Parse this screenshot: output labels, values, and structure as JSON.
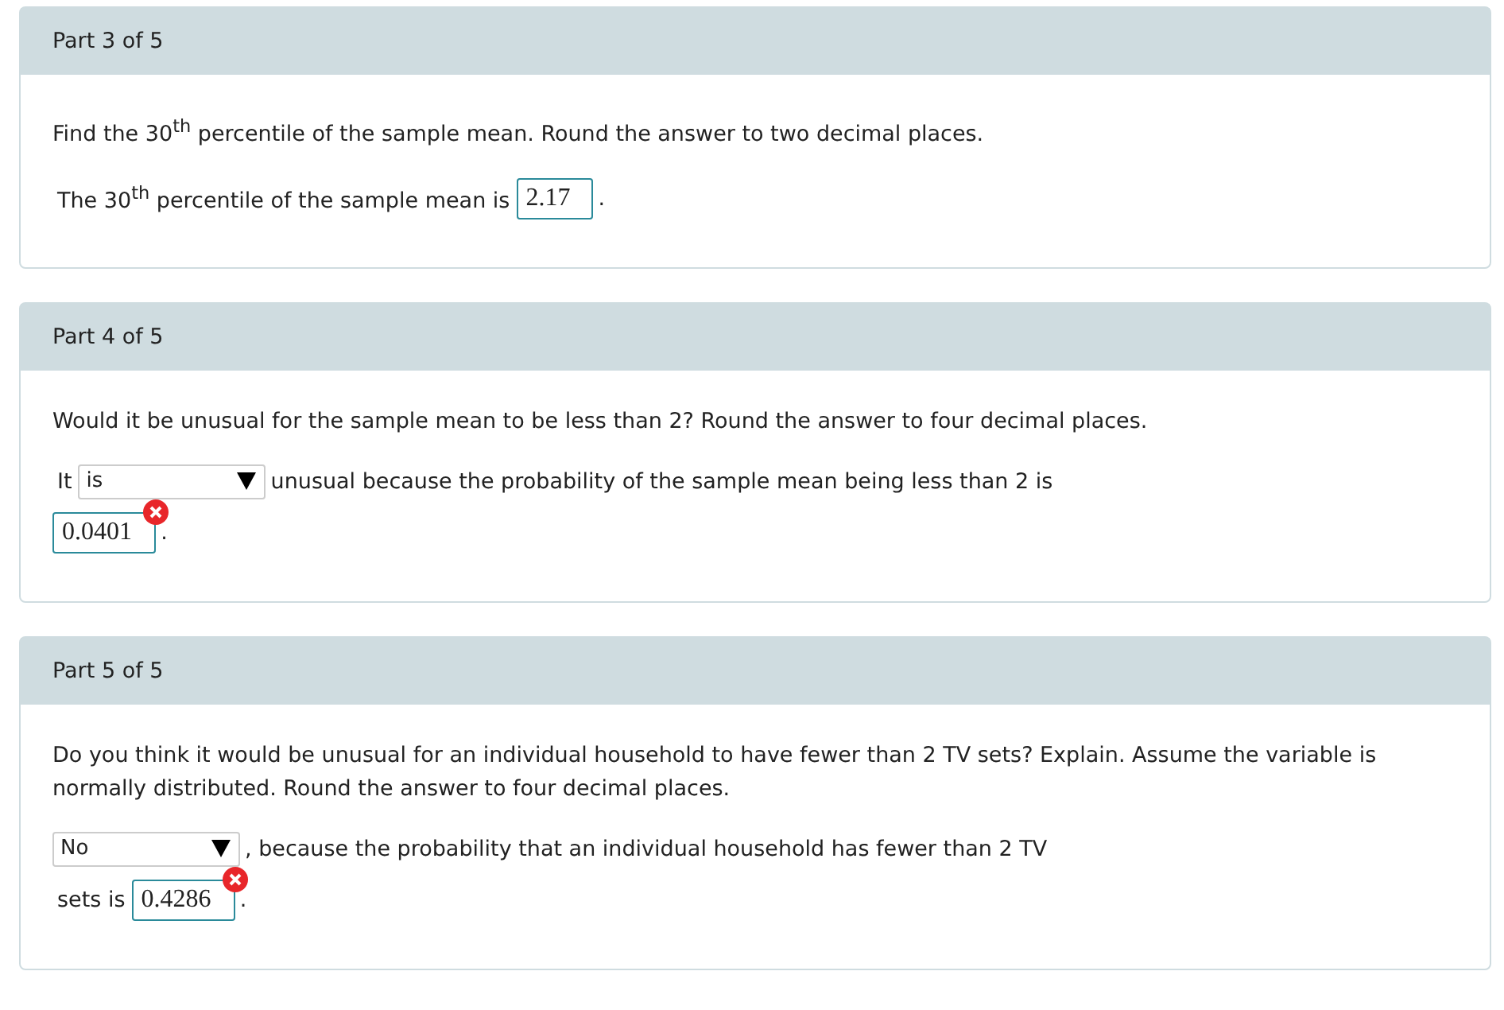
{
  "parts": [
    {
      "title": "Part 3 of 5",
      "question": "Find the 30$^{th}$ percentile of the sample mean. Round the answer to two decimal places.",
      "answer": [
        {
          "kind": "text",
          "text": "The 30$^{th}$ percentile of the sample mean is"
        },
        {
          "kind": "input",
          "value": "2.17",
          "incorrect": false
        },
        {
          "kind": "text",
          "text": "."
        }
      ]
    },
    {
      "title": "Part 4 of 5",
      "question": "Would it be unusual for the sample mean to be less than 2? Round the answer to four decimal places.",
      "answer": [
        {
          "kind": "text",
          "text": "It"
        },
        {
          "kind": "select",
          "value": "is"
        },
        {
          "kind": "text",
          "text": "unusual because the probability of the sample mean being less than 2 is"
        },
        {
          "kind": "break"
        },
        {
          "kind": "input",
          "value": "0.0401",
          "incorrect": true
        },
        {
          "kind": "text",
          "text": "."
        }
      ]
    },
    {
      "title": "Part 5 of 5",
      "question": "Do you think it would be unusual for an individual household to have fewer than 2 TV sets? Explain. Assume the variable is normally distributed. Round the answer to four decimal places.",
      "answer": [
        {
          "kind": "select",
          "value": "No"
        },
        {
          "kind": "text",
          "text": ", because the probability that an individual household has fewer than 2 TV"
        },
        {
          "kind": "break"
        },
        {
          "kind": "text",
          "text": "sets is"
        },
        {
          "kind": "input",
          "value": "0.4286",
          "incorrect": true
        },
        {
          "kind": "text",
          "text": "."
        }
      ]
    }
  ]
}
